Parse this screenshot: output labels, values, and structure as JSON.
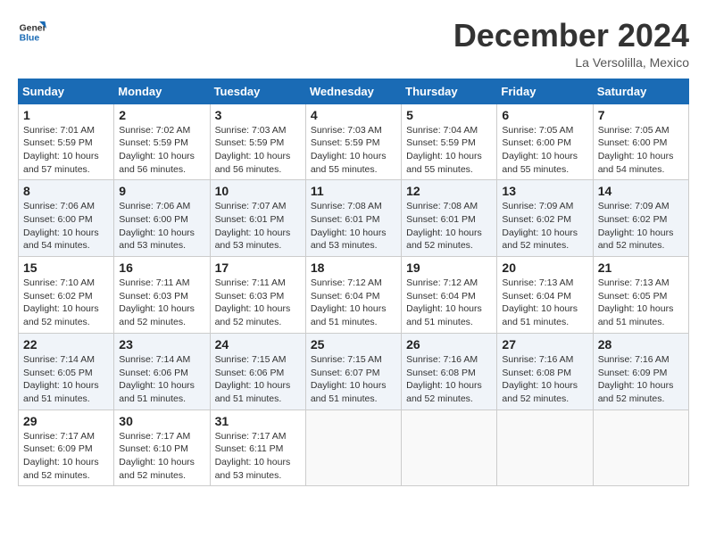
{
  "header": {
    "logo_line1": "General",
    "logo_line2": "Blue",
    "month": "December 2024",
    "location": "La Versolilla, Mexico"
  },
  "weekdays": [
    "Sunday",
    "Monday",
    "Tuesday",
    "Wednesday",
    "Thursday",
    "Friday",
    "Saturday"
  ],
  "weeks": [
    [
      {
        "day": "1",
        "info": "Sunrise: 7:01 AM\nSunset: 5:59 PM\nDaylight: 10 hours\nand 57 minutes."
      },
      {
        "day": "2",
        "info": "Sunrise: 7:02 AM\nSunset: 5:59 PM\nDaylight: 10 hours\nand 56 minutes."
      },
      {
        "day": "3",
        "info": "Sunrise: 7:03 AM\nSunset: 5:59 PM\nDaylight: 10 hours\nand 56 minutes."
      },
      {
        "day": "4",
        "info": "Sunrise: 7:03 AM\nSunset: 5:59 PM\nDaylight: 10 hours\nand 55 minutes."
      },
      {
        "day": "5",
        "info": "Sunrise: 7:04 AM\nSunset: 5:59 PM\nDaylight: 10 hours\nand 55 minutes."
      },
      {
        "day": "6",
        "info": "Sunrise: 7:05 AM\nSunset: 6:00 PM\nDaylight: 10 hours\nand 55 minutes."
      },
      {
        "day": "7",
        "info": "Sunrise: 7:05 AM\nSunset: 6:00 PM\nDaylight: 10 hours\nand 54 minutes."
      }
    ],
    [
      {
        "day": "8",
        "info": "Sunrise: 7:06 AM\nSunset: 6:00 PM\nDaylight: 10 hours\nand 54 minutes."
      },
      {
        "day": "9",
        "info": "Sunrise: 7:06 AM\nSunset: 6:00 PM\nDaylight: 10 hours\nand 53 minutes."
      },
      {
        "day": "10",
        "info": "Sunrise: 7:07 AM\nSunset: 6:01 PM\nDaylight: 10 hours\nand 53 minutes."
      },
      {
        "day": "11",
        "info": "Sunrise: 7:08 AM\nSunset: 6:01 PM\nDaylight: 10 hours\nand 53 minutes."
      },
      {
        "day": "12",
        "info": "Sunrise: 7:08 AM\nSunset: 6:01 PM\nDaylight: 10 hours\nand 52 minutes."
      },
      {
        "day": "13",
        "info": "Sunrise: 7:09 AM\nSunset: 6:02 PM\nDaylight: 10 hours\nand 52 minutes."
      },
      {
        "day": "14",
        "info": "Sunrise: 7:09 AM\nSunset: 6:02 PM\nDaylight: 10 hours\nand 52 minutes."
      }
    ],
    [
      {
        "day": "15",
        "info": "Sunrise: 7:10 AM\nSunset: 6:02 PM\nDaylight: 10 hours\nand 52 minutes."
      },
      {
        "day": "16",
        "info": "Sunrise: 7:11 AM\nSunset: 6:03 PM\nDaylight: 10 hours\nand 52 minutes."
      },
      {
        "day": "17",
        "info": "Sunrise: 7:11 AM\nSunset: 6:03 PM\nDaylight: 10 hours\nand 52 minutes."
      },
      {
        "day": "18",
        "info": "Sunrise: 7:12 AM\nSunset: 6:04 PM\nDaylight: 10 hours\nand 51 minutes."
      },
      {
        "day": "19",
        "info": "Sunrise: 7:12 AM\nSunset: 6:04 PM\nDaylight: 10 hours\nand 51 minutes."
      },
      {
        "day": "20",
        "info": "Sunrise: 7:13 AM\nSunset: 6:04 PM\nDaylight: 10 hours\nand 51 minutes."
      },
      {
        "day": "21",
        "info": "Sunrise: 7:13 AM\nSunset: 6:05 PM\nDaylight: 10 hours\nand 51 minutes."
      }
    ],
    [
      {
        "day": "22",
        "info": "Sunrise: 7:14 AM\nSunset: 6:05 PM\nDaylight: 10 hours\nand 51 minutes."
      },
      {
        "day": "23",
        "info": "Sunrise: 7:14 AM\nSunset: 6:06 PM\nDaylight: 10 hours\nand 51 minutes."
      },
      {
        "day": "24",
        "info": "Sunrise: 7:15 AM\nSunset: 6:06 PM\nDaylight: 10 hours\nand 51 minutes."
      },
      {
        "day": "25",
        "info": "Sunrise: 7:15 AM\nSunset: 6:07 PM\nDaylight: 10 hours\nand 51 minutes."
      },
      {
        "day": "26",
        "info": "Sunrise: 7:16 AM\nSunset: 6:08 PM\nDaylight: 10 hours\nand 52 minutes."
      },
      {
        "day": "27",
        "info": "Sunrise: 7:16 AM\nSunset: 6:08 PM\nDaylight: 10 hours\nand 52 minutes."
      },
      {
        "day": "28",
        "info": "Sunrise: 7:16 AM\nSunset: 6:09 PM\nDaylight: 10 hours\nand 52 minutes."
      }
    ],
    [
      {
        "day": "29",
        "info": "Sunrise: 7:17 AM\nSunset: 6:09 PM\nDaylight: 10 hours\nand 52 minutes."
      },
      {
        "day": "30",
        "info": "Sunrise: 7:17 AM\nSunset: 6:10 PM\nDaylight: 10 hours\nand 52 minutes."
      },
      {
        "day": "31",
        "info": "Sunrise: 7:17 AM\nSunset: 6:11 PM\nDaylight: 10 hours\nand 53 minutes."
      },
      {
        "day": "",
        "info": ""
      },
      {
        "day": "",
        "info": ""
      },
      {
        "day": "",
        "info": ""
      },
      {
        "day": "",
        "info": ""
      }
    ]
  ]
}
